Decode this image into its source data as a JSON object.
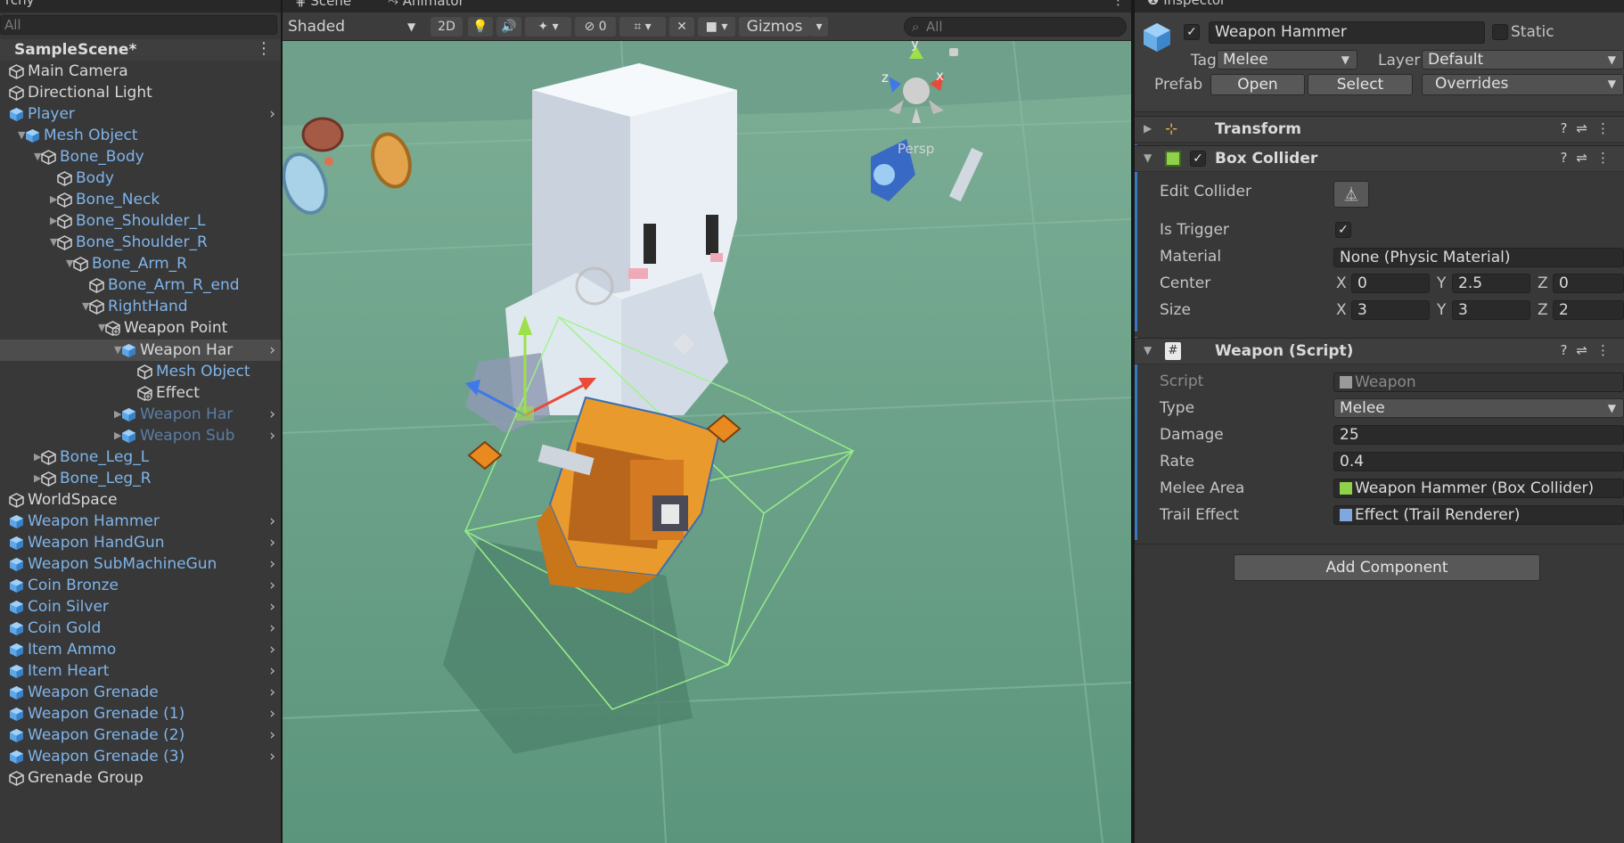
{
  "hierarchy": {
    "tab": "rchy",
    "search_placeholder": "All",
    "scene_name": "SampleScene*",
    "rows": [
      {
        "label": "Main Camera",
        "depth": 0,
        "fold": "",
        "color": "white",
        "icon": "gameobject-icon",
        "arrow": false
      },
      {
        "label": "Directional Light",
        "depth": 0,
        "fold": "",
        "color": "white",
        "icon": "gameobject-icon",
        "arrow": false
      },
      {
        "label": "Player",
        "depth": 0,
        "fold": "",
        "color": "blue",
        "icon": "prefab-icon",
        "arrow": true
      },
      {
        "label": "Mesh Object",
        "depth": 1,
        "fold": "down",
        "color": "blue",
        "icon": "prefab-icon",
        "arrow": false
      },
      {
        "label": "Bone_Body",
        "depth": 2,
        "fold": "down",
        "color": "blue",
        "icon": "gameobject-icon",
        "arrow": false
      },
      {
        "label": "Body",
        "depth": 3,
        "fold": "",
        "color": "blue",
        "icon": "gameobject-icon",
        "arrow": false
      },
      {
        "label": "Bone_Neck",
        "depth": 3,
        "fold": "right",
        "color": "blue",
        "icon": "gameobject-icon",
        "arrow": false
      },
      {
        "label": "Bone_Shoulder_L",
        "depth": 3,
        "fold": "right",
        "color": "blue",
        "icon": "gameobject-icon",
        "arrow": false
      },
      {
        "label": "Bone_Shoulder_R",
        "depth": 3,
        "fold": "down",
        "color": "blue",
        "icon": "gameobject-icon",
        "arrow": false
      },
      {
        "label": "Bone_Arm_R",
        "depth": 4,
        "fold": "down",
        "color": "blue",
        "icon": "gameobject-icon",
        "arrow": false
      },
      {
        "label": "Bone_Arm_R_end",
        "depth": 5,
        "fold": "",
        "color": "blue",
        "icon": "gameobject-icon",
        "arrow": false
      },
      {
        "label": "RightHand",
        "depth": 5,
        "fold": "down",
        "color": "blue",
        "icon": "gameobject-icon",
        "arrow": false
      },
      {
        "label": "Weapon Point",
        "depth": 6,
        "fold": "down",
        "color": "white",
        "icon": "gameobject-added-icon",
        "arrow": false
      },
      {
        "label": "Weapon Har",
        "depth": 7,
        "fold": "down",
        "color": "white",
        "icon": "prefab-icon",
        "arrow": true,
        "selected": true
      },
      {
        "label": "Mesh Object",
        "depth": 8,
        "fold": "",
        "color": "blue",
        "icon": "gameobject-icon",
        "arrow": false
      },
      {
        "label": "Effect",
        "depth": 8,
        "fold": "",
        "color": "white",
        "icon": "gameobject-added-icon",
        "arrow": false
      },
      {
        "label": "Weapon Har",
        "depth": 7,
        "fold": "right",
        "color": "dim",
        "icon": "prefab-icon",
        "arrow": true
      },
      {
        "label": "Weapon Sub",
        "depth": 7,
        "fold": "right",
        "color": "dim",
        "icon": "prefab-icon",
        "arrow": true
      },
      {
        "label": "Bone_Leg_L",
        "depth": 2,
        "fold": "right",
        "color": "blue",
        "icon": "gameobject-icon",
        "arrow": false
      },
      {
        "label": "Bone_Leg_R",
        "depth": 2,
        "fold": "right",
        "color": "blue",
        "icon": "gameobject-icon",
        "arrow": false
      },
      {
        "label": "WorldSpace",
        "depth": 0,
        "fold": "",
        "color": "white",
        "icon": "gameobject-icon",
        "arrow": false
      },
      {
        "label": "Weapon Hammer",
        "depth": 0,
        "fold": "",
        "color": "blue",
        "icon": "prefab-icon",
        "arrow": true
      },
      {
        "label": "Weapon HandGun",
        "depth": 0,
        "fold": "",
        "color": "blue",
        "icon": "prefab-icon",
        "arrow": true
      },
      {
        "label": "Weapon SubMachineGun",
        "depth": 0,
        "fold": "",
        "color": "blue",
        "icon": "prefab-icon",
        "arrow": true
      },
      {
        "label": "Coin Bronze",
        "depth": 0,
        "fold": "",
        "color": "blue",
        "icon": "prefab-icon",
        "arrow": true
      },
      {
        "label": "Coin Silver",
        "depth": 0,
        "fold": "",
        "color": "blue",
        "icon": "prefab-icon",
        "arrow": true
      },
      {
        "label": "Coin Gold",
        "depth": 0,
        "fold": "",
        "color": "blue",
        "icon": "prefab-icon",
        "arrow": true
      },
      {
        "label": "Item Ammo",
        "depth": 0,
        "fold": "",
        "color": "blue",
        "icon": "prefab-icon",
        "arrow": true
      },
      {
        "label": "Item Heart",
        "depth": 0,
        "fold": "",
        "color": "blue",
        "icon": "prefab-icon",
        "arrow": true
      },
      {
        "label": "Weapon Grenade",
        "depth": 0,
        "fold": "",
        "color": "blue",
        "icon": "prefab-icon",
        "arrow": true
      },
      {
        "label": "Weapon Grenade (1)",
        "depth": 0,
        "fold": "",
        "color": "blue",
        "icon": "prefab-icon",
        "arrow": true
      },
      {
        "label": "Weapon Grenade (2)",
        "depth": 0,
        "fold": "",
        "color": "blue",
        "icon": "prefab-icon",
        "arrow": true
      },
      {
        "label": "Weapon Grenade (3)",
        "depth": 0,
        "fold": "",
        "color": "blue",
        "icon": "prefab-icon",
        "arrow": true
      },
      {
        "label": "Grenade Group",
        "depth": 0,
        "fold": "",
        "color": "white",
        "icon": "gameobject-icon",
        "arrow": false
      }
    ]
  },
  "scene_view": {
    "tabs": [
      "Scene",
      "Animator"
    ],
    "shading_mode": "Shaded",
    "mode_2d": "2D",
    "hidden_count": "0",
    "gizmos_label": "Gizmos",
    "search_placeholder": "All",
    "gizmo_axes": {
      "y": "y",
      "x": "x",
      "z": "z"
    },
    "projection": "Persp"
  },
  "inspector": {
    "tab": "Inspector",
    "object_name": "Weapon Hammer",
    "active": true,
    "static_label": "Static",
    "tag_label": "Tag",
    "tag_value": "Melee",
    "layer_label": "Layer",
    "layer_value": "Default",
    "prefab_label": "Prefab",
    "prefab_open": "Open",
    "prefab_select": "Select",
    "prefab_overrides": "Overrides",
    "transform": {
      "title": "Transform"
    },
    "box_collider": {
      "title": "Box Collider",
      "enabled": true,
      "edit_collider_label": "Edit Collider",
      "is_trigger_label": "Is Trigger",
      "is_trigger": true,
      "material_label": "Material",
      "material_value": "None (Physic Material)",
      "center_label": "Center",
      "center": {
        "x": "0",
        "y": "2.5",
        "z": "0"
      },
      "size_label": "Size",
      "size": {
        "x": "3",
        "y": "3",
        "z": "2"
      },
      "axis_x": "X",
      "axis_y": "Y",
      "axis_z": "Z"
    },
    "weapon_script": {
      "title": "Weapon (Script)",
      "script_label": "Script",
      "script_value": "Weapon",
      "type_label": "Type",
      "type_value": "Melee",
      "damage_label": "Damage",
      "damage_value": "25",
      "rate_label": "Rate",
      "rate_value": "0.4",
      "melee_area_label": "Melee Area",
      "melee_area_value": "Weapon Hammer (Box Collider)",
      "trail_effect_label": "Trail Effect",
      "trail_effect_value": "Effect (Trail Renderer)"
    },
    "add_component": "Add Component"
  },
  "colors": {
    "panel_bg": "#383838",
    "scene_ground": "#5f9a82",
    "prefab_blue": "#7fb4ea",
    "selection_blue": "#3a79bb",
    "hammer_orange": "#e89a2c",
    "collider_green": "#9cf58a"
  }
}
